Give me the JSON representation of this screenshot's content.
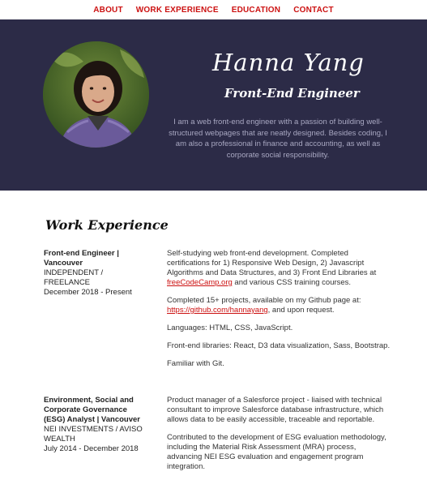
{
  "nav": {
    "items": [
      "ABOUT",
      "WORK EXPERIENCE",
      "EDUCATION",
      "CONTACT"
    ]
  },
  "hero": {
    "name": "Hanna Yang",
    "role": "Front-End Engineer",
    "bio": "I am a web front-end engineer with a passion of building well-structured webpages that are neatly designed. Besides coding, I am also a professional in finance and accounting, as well as corporate social responsibility.",
    "bg_color": "#2c2b47"
  },
  "work": {
    "section_title": "Work Experience",
    "jobs": [
      {
        "title": "Front-end Engineer | Vancouver",
        "company": "INDEPENDENT / FREELANCE",
        "dates": "December 2018 - Present",
        "p1_a": "Self-studying web front-end development. Completed certifications for 1) Responsive Web Design, 2) Javascript Algorithms and Data Structures, and 3) Front End Libraries at ",
        "p1_link": "freeCodeCamp.org",
        "p1_b": " and various CSS training courses.",
        "p2_a": "Completed 15+ projects, available on my Github page at: ",
        "p2_link": "https://github.com/hannayang",
        "p2_b": ", and upon request.",
        "p3": "Languages: HTML, CSS, JavaScript.",
        "p4": "Front-end libraries: React, D3 data visualization, Sass, Bootstrap.",
        "p5": "Familiar with Git."
      },
      {
        "title": "Environment, Social and Corporate Governance (ESG) Analyst | Vancouver",
        "company": "NEI INVESTMENTS / AVISO WEALTH",
        "dates": "July 2014 - December 2018",
        "p1": "Product manager of a Salesforce project - liaised with technical consultant to improve Salesforce database infrastructure, which allows data to be easily accessible, traceable and reportable.",
        "p2": "Contributed to the development of ESG evaluation methodology, including the Material Risk Assessment (MRA) process, advancing NEI ESG evaluation and engagement program integration."
      }
    ]
  },
  "colors": {
    "accent": "#cc1111",
    "bio_text": "#a9a8c2"
  }
}
